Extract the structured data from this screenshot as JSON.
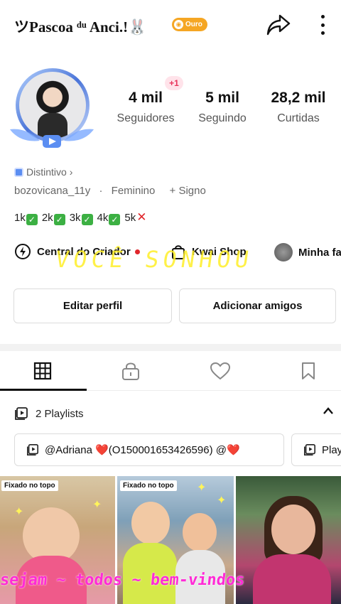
{
  "header": {
    "username": "ツPascoa ᵈᵘ Anci.!🐰",
    "level_badge": "Ouro",
    "share_icon": "share-arrow-icon",
    "more_icon": "more-vertical-icon"
  },
  "profile": {
    "new_followers_badge": "+1",
    "stats": [
      {
        "value": "4 mil",
        "label": "Seguidores"
      },
      {
        "value": "5 mil",
        "label": "Seguindo"
      },
      {
        "value": "28,2 mil",
        "label": "Curtidas"
      }
    ],
    "distintivo": "Distintivo",
    "handle": "bozovicana_11y",
    "gender": "Feminino",
    "sign": "+ Signo",
    "goals": {
      "done": [
        "1k",
        "2k",
        "3k",
        "4k"
      ],
      "pending": "5k"
    }
  },
  "shortcuts": [
    {
      "label": "Central do Criador",
      "icon": "lightning-icon"
    },
    {
      "label": "Kwai Shop",
      "icon": "shopping-bag-icon"
    },
    {
      "label": "Minha fa",
      "icon": "avatar-icon"
    }
  ],
  "overlay_texts": {
    "yellow": "VOCÊ SONHOU",
    "magenta": "sejam ~ todos ~ bem-vindos"
  },
  "actions": {
    "edit_profile": "Editar perfil",
    "add_friends": "Adicionar amigos"
  },
  "tabs": [
    {
      "name": "grid",
      "icon": "grid-icon",
      "active": true
    },
    {
      "name": "private",
      "icon": "lock-icon",
      "active": false
    },
    {
      "name": "liked",
      "icon": "heart-icon",
      "active": false
    },
    {
      "name": "saved",
      "icon": "bookmark-icon",
      "active": false
    }
  ],
  "playlists": {
    "label": "2 Playlists",
    "items": [
      {
        "title": "@Adriana ❤️(O150001653426596) @❤️"
      },
      {
        "title": "Play"
      }
    ]
  },
  "videos": [
    {
      "pinned_label": "Fixado no topo"
    },
    {
      "pinned_label": "Fixado no topo"
    },
    {
      "pinned_label": ""
    }
  ],
  "colors": {
    "badge_gold": "#f5a623",
    "accent_red": "#e0262b",
    "check_green": "#3cb043",
    "overlay_yellow": "#ffee28",
    "overlay_magenta": "#ff2bd6"
  }
}
